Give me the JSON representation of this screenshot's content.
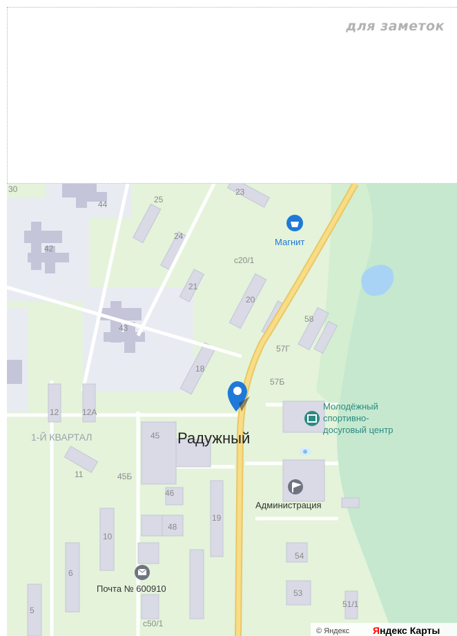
{
  "notes": {
    "title": "для заметок"
  },
  "map": {
    "city_label": "Радужный",
    "district_label": "1-Й КВАРТАЛ",
    "pois": {
      "magnit": "Магнит",
      "sport_center_line1": "Молодёжный",
      "sport_center_line2": "спортивно-",
      "sport_center_line3": "досуговый центр",
      "administration": "Администрация",
      "post": "Почта № 600910"
    },
    "buildings": {
      "b30": "30",
      "b44": "44",
      "b25": "25",
      "b23": "23",
      "b42": "42",
      "b24": "24",
      "bc20_1": "с20/1",
      "b21": "21",
      "b20": "20",
      "b43": "43",
      "b58": "58",
      "b57g": "57Г",
      "b18": "18",
      "b57b": "57Б",
      "b12": "12",
      "b12a": "12А",
      "b45": "45",
      "b11": "11",
      "b45b": "45Б",
      "b46": "46",
      "b19": "19",
      "b10": "10",
      "b48": "48",
      "b54": "54",
      "b6": "6",
      "b53": "53",
      "b51_1": "51/1",
      "b5": "5",
      "bc50_1": "с50/1"
    },
    "copyright": "© Яндекс",
    "brand": {
      "part1": "Я",
      "part2": "ндекс Карты"
    }
  },
  "colors": {
    "park": "#c9eac3",
    "forest": "#bfe6c9",
    "residential": "#e9ebf3",
    "building": "#c4c5d9",
    "road": "#ffffff",
    "main_road": "#f7d97a",
    "water": "#a9d3f5",
    "poi_blue": "#1f79d8",
    "poi_teal": "#2c8a82",
    "brand_red": "#ff0000"
  }
}
